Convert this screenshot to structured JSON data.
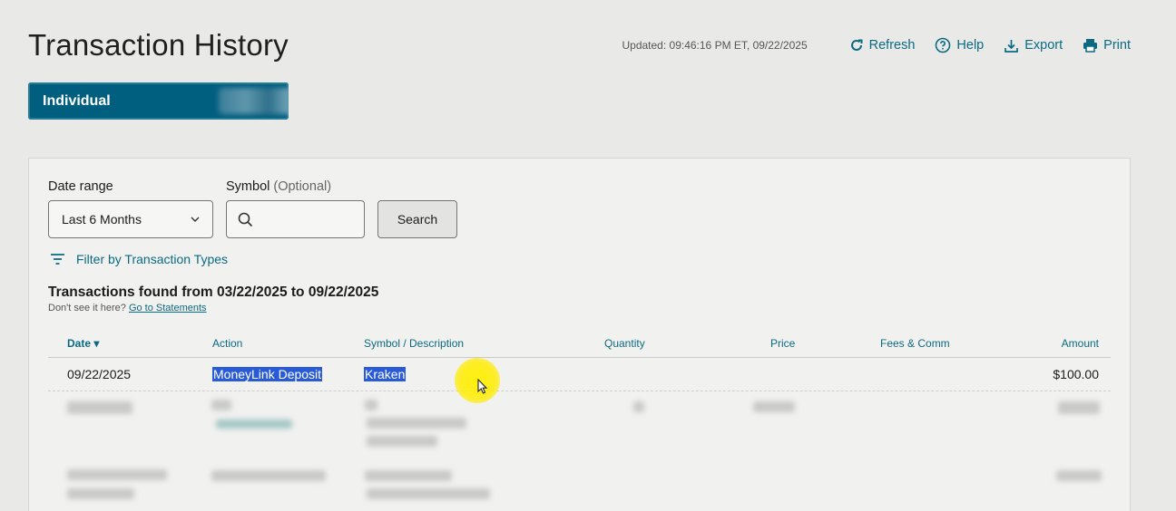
{
  "page": {
    "title": "Transaction History"
  },
  "header": {
    "updated": "Updated: 09:46:16 PM ET, 09/22/2025",
    "actions": [
      {
        "label": "Refresh",
        "icon": "refresh-icon"
      },
      {
        "label": "Help",
        "icon": "help-icon"
      },
      {
        "label": "Export",
        "icon": "export-icon"
      },
      {
        "label": "Print",
        "icon": "print-icon"
      }
    ]
  },
  "account": {
    "label": "Individual"
  },
  "filters": {
    "date_range_label": "Date range",
    "date_range_value": "Last 6 Months",
    "symbol_label": "Symbol",
    "symbol_optional": "(Optional)",
    "symbol_placeholder": "",
    "search_label": "Search",
    "filter_types_label": "Filter by Transaction Types"
  },
  "results": {
    "found_text": "Transactions found from 03/22/2025 to 09/22/2025",
    "dont_see_text": "Don't see it here?",
    "statements_link": "Go to Statements"
  },
  "table": {
    "columns": [
      "Date ▾",
      "Action",
      "Symbol / Description",
      "Quantity",
      "Price",
      "Fees & Comm",
      "Amount"
    ],
    "rows": [
      {
        "date": "09/22/2025",
        "action": "MoneyLink Deposit",
        "symbol": "Kraken",
        "quantity": "",
        "price": "",
        "fees": "",
        "amount": "$100.00"
      }
    ]
  },
  "colors": {
    "accent": "#0b6a82",
    "pill": "#005f7f",
    "highlight": "#2a5bd7",
    "cursor": "#ffec00"
  }
}
